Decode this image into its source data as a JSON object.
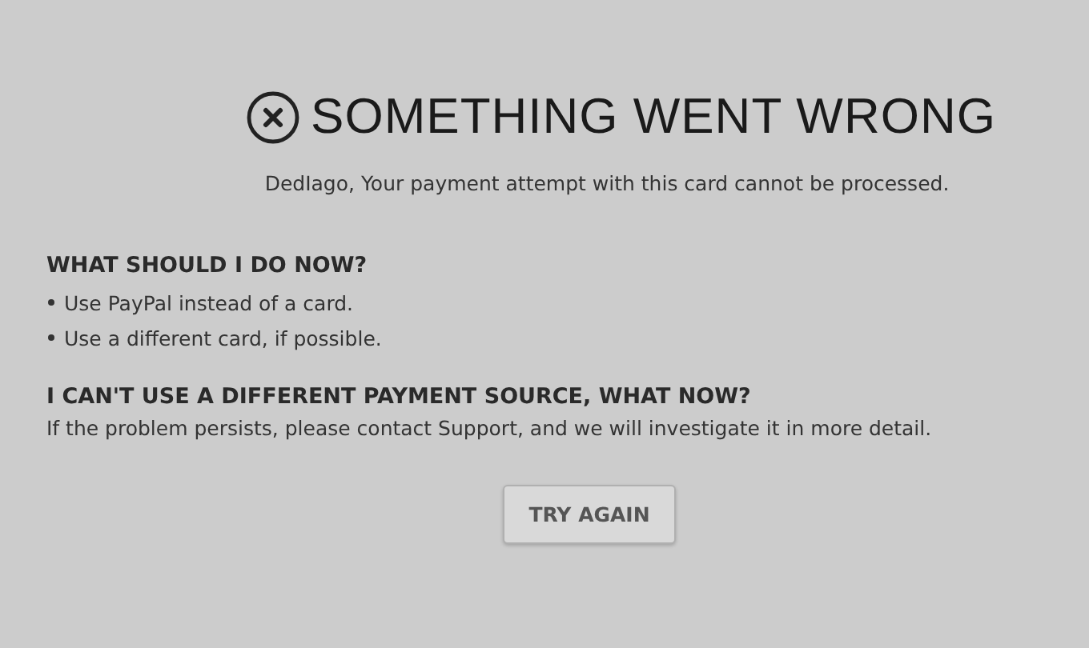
{
  "title": "SOMETHING WENT WRONG",
  "message": "DedIago, Your payment attempt with this card cannot be processed.",
  "sections": [
    {
      "heading": "WHAT SHOULD I DO NOW?",
      "kind": "list",
      "items": [
        "Use PayPal instead of a card.",
        "Use a different card, if possible."
      ]
    },
    {
      "heading": "I CAN'T USE A DIFFERENT PAYMENT SOURCE, WHAT NOW?",
      "kind": "text",
      "text": "If the problem persists, please contact Support, and we will investigate it in more detail."
    }
  ],
  "button": "TRY AGAIN"
}
